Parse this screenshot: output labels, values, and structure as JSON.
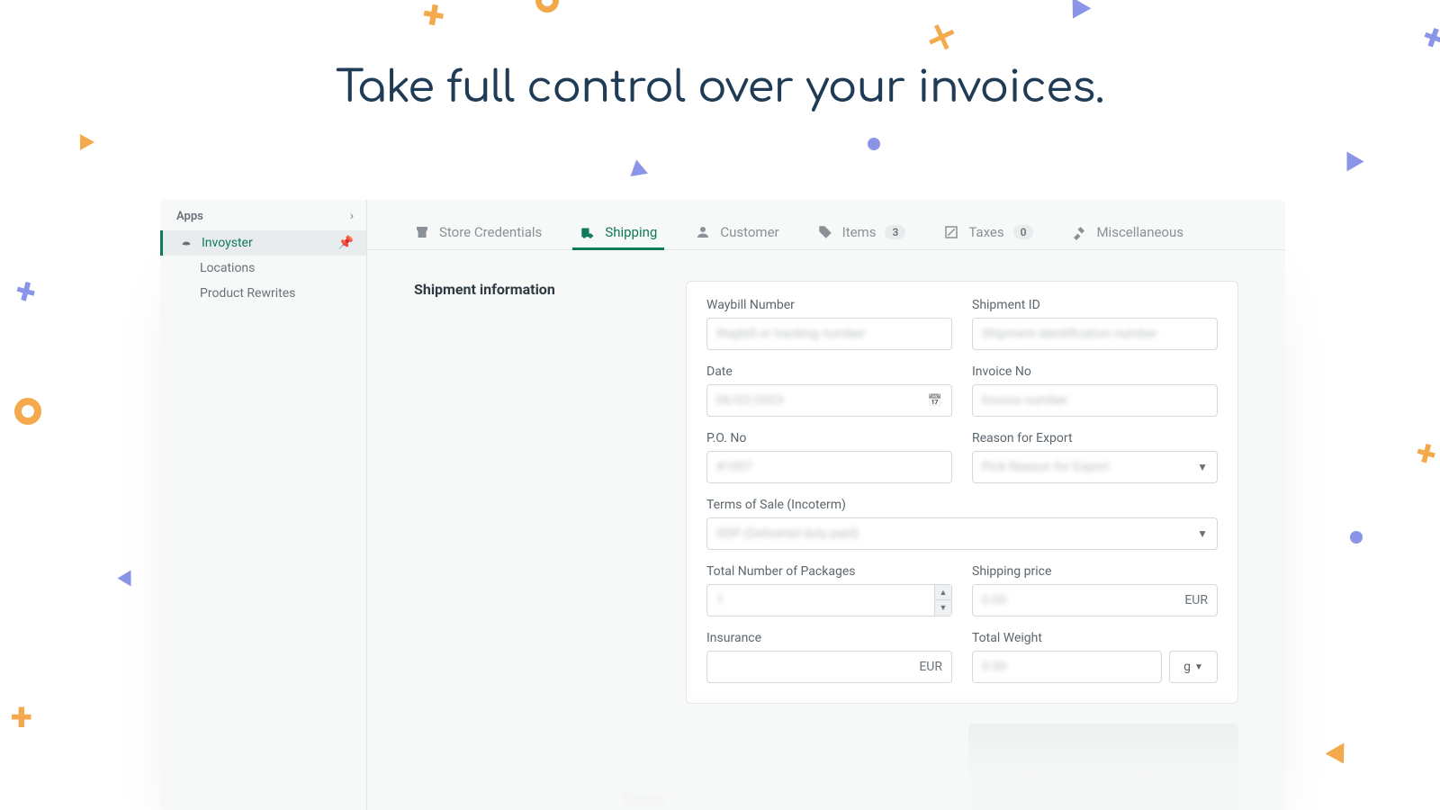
{
  "headline": "Take full control over your invoices.",
  "sidebar": {
    "header": "Apps",
    "items": [
      {
        "label": "Invoyster",
        "active": true
      },
      {
        "label": "Locations"
      },
      {
        "label": "Product Rewrites"
      }
    ]
  },
  "tabs": {
    "store": "Store Credentials",
    "shipping": "Shipping",
    "customer": "Customer",
    "items": "Items",
    "items_badge": "3",
    "taxes": "Taxes",
    "taxes_badge": "0",
    "misc": "Miscellaneous"
  },
  "section": {
    "title": "Shipment information"
  },
  "form": {
    "waybill": {
      "label": "Waybill Number",
      "placeholder": "Waybill or tracking number"
    },
    "shipment_id": {
      "label": "Shipment ID",
      "placeholder": "Shipment identification number"
    },
    "date": {
      "label": "Date",
      "value": "06/02/2023"
    },
    "invoice_no": {
      "label": "Invoice No",
      "placeholder": "Invoice number"
    },
    "po_no": {
      "label": "P.O. No",
      "value": "#1007"
    },
    "reason": {
      "label": "Reason for Export",
      "value": "Pick Reason for Export"
    },
    "incoterm": {
      "label": "Terms of Sale (Incoterm)",
      "value": "DDP (Delivered duty paid)"
    },
    "packages": {
      "label": "Total Number of Packages",
      "value": "1"
    },
    "ship_price": {
      "label": "Shipping price",
      "value": "0.00",
      "currency": "EUR"
    },
    "insurance": {
      "label": "Insurance",
      "currency": "EUR"
    },
    "weight": {
      "label": "Total Weight",
      "value": "0.00",
      "unit": "g"
    }
  },
  "totals": {
    "title": "Totals"
  }
}
